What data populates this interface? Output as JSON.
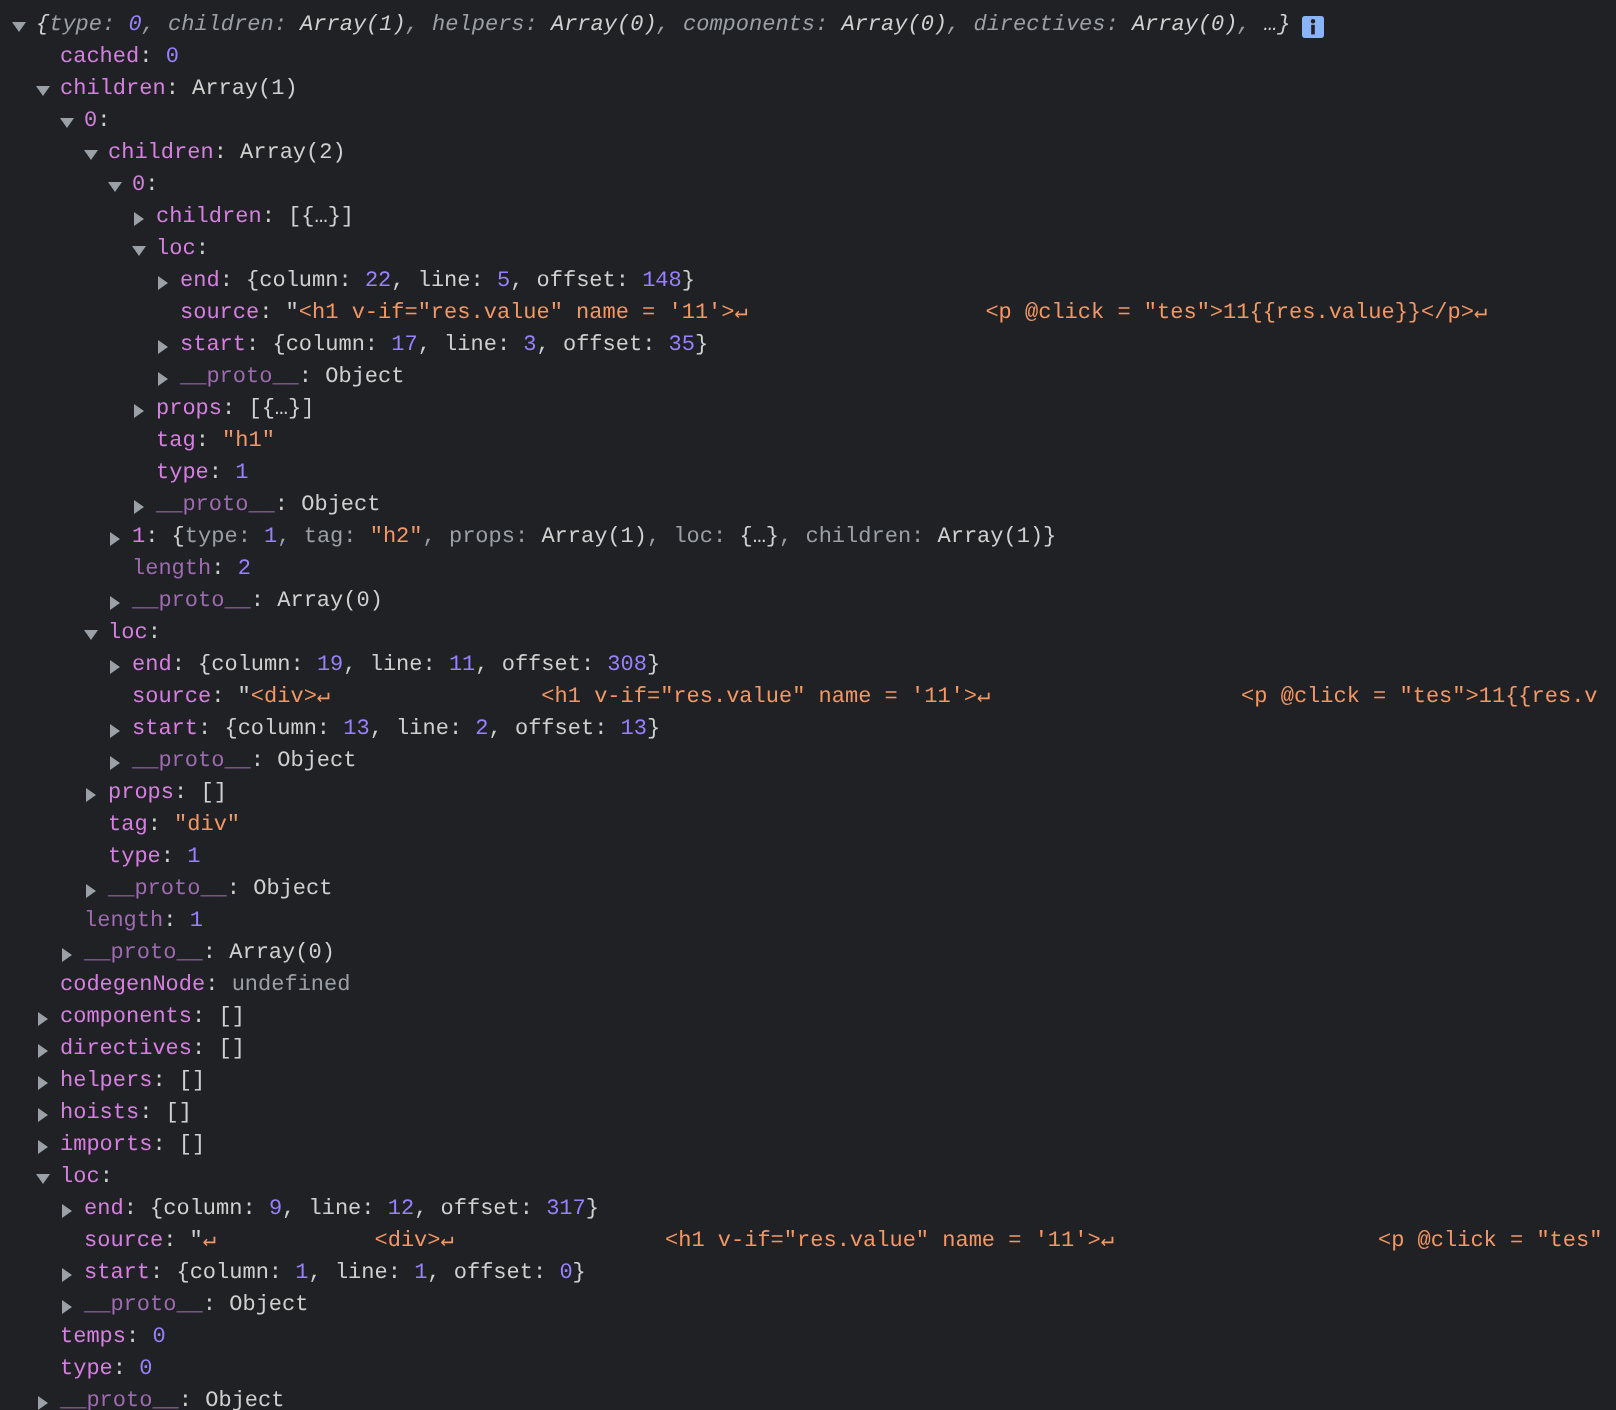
{
  "console": {
    "root": {
      "expanded": true,
      "info_badge": true,
      "preview": [
        {
          "kind": "plain",
          "text": "{"
        },
        {
          "kind": "preview-key",
          "text": "type: "
        },
        {
          "kind": "number",
          "text": "0"
        },
        {
          "kind": "preview-key",
          "text": ", children: "
        },
        {
          "kind": "plain",
          "text": "Array(1)"
        },
        {
          "kind": "preview-key",
          "text": ", helpers: "
        },
        {
          "kind": "plain",
          "text": "Array(0)"
        },
        {
          "kind": "preview-key",
          "text": ", components: "
        },
        {
          "kind": "plain",
          "text": "Array(0)"
        },
        {
          "kind": "preview-key",
          "text": ", directives: "
        },
        {
          "kind": "plain",
          "text": "Array(0)"
        },
        {
          "kind": "preview-key",
          "text": ", "
        },
        {
          "kind": "plain",
          "text": "…}"
        }
      ],
      "children": [
        {
          "key": "cached",
          "kind": "property",
          "tokens": [
            {
              "kind": "plain",
              "text": ": "
            },
            {
              "kind": "number",
              "text": "0"
            }
          ]
        },
        {
          "key": "children",
          "kind": "property",
          "expanded": true,
          "tokens": [
            {
              "kind": "plain",
              "text": ": Array(1)"
            }
          ],
          "children": [
            {
              "key": "0",
              "kind": "property",
              "expanded": true,
              "tokens": [
                {
                  "kind": "plain",
                  "text": ":"
                }
              ],
              "children": [
                {
                  "key": "children",
                  "kind": "property",
                  "expanded": true,
                  "tokens": [
                    {
                      "kind": "plain",
                      "text": ": Array(2)"
                    }
                  ],
                  "children": [
                    {
                      "key": "0",
                      "kind": "property",
                      "expanded": true,
                      "tokens": [
                        {
                          "kind": "plain",
                          "text": ":"
                        }
                      ],
                      "children": [
                        {
                          "key": "children",
                          "kind": "property",
                          "expanded": false,
                          "tokens": [
                            {
                              "kind": "plain",
                              "text": ": [{…}]"
                            }
                          ]
                        },
                        {
                          "key": "loc",
                          "kind": "property",
                          "expanded": true,
                          "tokens": [
                            {
                              "kind": "plain",
                              "text": ":"
                            }
                          ],
                          "children": [
                            {
                              "key": "end",
                              "kind": "property",
                              "expanded": false,
                              "tokens": [
                                {
                                  "kind": "plain",
                                  "text": ": {column: "
                                },
                                {
                                  "kind": "number",
                                  "text": "22"
                                },
                                {
                                  "kind": "plain",
                                  "text": ", line: "
                                },
                                {
                                  "kind": "number",
                                  "text": "5"
                                },
                                {
                                  "kind": "plain",
                                  "text": ", offset: "
                                },
                                {
                                  "kind": "number",
                                  "text": "148"
                                },
                                {
                                  "kind": "plain",
                                  "text": "}"
                                }
                              ]
                            },
                            {
                              "key": "source",
                              "kind": "property",
                              "tokens": [
                                {
                                  "kind": "plain",
                                  "text": ": \""
                                },
                                {
                                  "kind": "string",
                                  "text": "<h1 v-if=\"res.value\" name = '11'>↵                  <p @click = \"tes\">11{{res.value}}</p>↵"
                                }
                              ]
                            },
                            {
                              "key": "start",
                              "kind": "property",
                              "expanded": false,
                              "tokens": [
                                {
                                  "kind": "plain",
                                  "text": ": {column: "
                                },
                                {
                                  "kind": "number",
                                  "text": "17"
                                },
                                {
                                  "kind": "plain",
                                  "text": ", line: "
                                },
                                {
                                  "kind": "number",
                                  "text": "3"
                                },
                                {
                                  "kind": "plain",
                                  "text": ", offset: "
                                },
                                {
                                  "kind": "number",
                                  "text": "35"
                                },
                                {
                                  "kind": "plain",
                                  "text": "}"
                                }
                              ]
                            },
                            {
                              "key": "__proto__",
                              "kind": "internal",
                              "expanded": false,
                              "tokens": [
                                {
                                  "kind": "plain",
                                  "text": ": Object"
                                }
                              ]
                            }
                          ]
                        },
                        {
                          "key": "props",
                          "kind": "property",
                          "expanded": false,
                          "tokens": [
                            {
                              "kind": "plain",
                              "text": ": [{…}]"
                            }
                          ]
                        },
                        {
                          "key": "tag",
                          "kind": "property",
                          "tokens": [
                            {
                              "kind": "plain",
                              "text": ": "
                            },
                            {
                              "kind": "string",
                              "text": "\"h1\""
                            }
                          ]
                        },
                        {
                          "key": "type",
                          "kind": "property",
                          "tokens": [
                            {
                              "kind": "plain",
                              "text": ": "
                            },
                            {
                              "kind": "number",
                              "text": "1"
                            }
                          ]
                        },
                        {
                          "key": "__proto__",
                          "kind": "internal",
                          "expanded": false,
                          "tokens": [
                            {
                              "kind": "plain",
                              "text": ": Object"
                            }
                          ]
                        }
                      ]
                    },
                    {
                      "key": "1",
                      "kind": "property",
                      "expanded": false,
                      "tokens": [
                        {
                          "kind": "plain",
                          "text": ": {"
                        },
                        {
                          "kind": "preview-key",
                          "text": "type: "
                        },
                        {
                          "kind": "number",
                          "text": "1"
                        },
                        {
                          "kind": "preview-key",
                          "text": ", tag: "
                        },
                        {
                          "kind": "string",
                          "text": "\"h2\""
                        },
                        {
                          "kind": "preview-key",
                          "text": ", props: "
                        },
                        {
                          "kind": "plain",
                          "text": "Array(1)"
                        },
                        {
                          "kind": "preview-key",
                          "text": ", loc: "
                        },
                        {
                          "kind": "plain",
                          "text": "{…}"
                        },
                        {
                          "kind": "preview-key",
                          "text": ", children: "
                        },
                        {
                          "kind": "plain",
                          "text": "Array(1)}"
                        }
                      ]
                    },
                    {
                      "key": "length",
                      "kind": "internal",
                      "tokens": [
                        {
                          "kind": "plain",
                          "text": ": "
                        },
                        {
                          "kind": "number",
                          "text": "2"
                        }
                      ]
                    },
                    {
                      "key": "__proto__",
                      "kind": "internal",
                      "expanded": false,
                      "tokens": [
                        {
                          "kind": "plain",
                          "text": ": Array(0)"
                        }
                      ]
                    }
                  ]
                },
                {
                  "key": "loc",
                  "kind": "property",
                  "expanded": true,
                  "tokens": [
                    {
                      "kind": "plain",
                      "text": ":"
                    }
                  ],
                  "children": [
                    {
                      "key": "end",
                      "kind": "property",
                      "expanded": false,
                      "tokens": [
                        {
                          "kind": "plain",
                          "text": ": {column: "
                        },
                        {
                          "kind": "number",
                          "text": "19"
                        },
                        {
                          "kind": "plain",
                          "text": ", line: "
                        },
                        {
                          "kind": "number",
                          "text": "11"
                        },
                        {
                          "kind": "plain",
                          "text": ", offset: "
                        },
                        {
                          "kind": "number",
                          "text": "308"
                        },
                        {
                          "kind": "plain",
                          "text": "}"
                        }
                      ]
                    },
                    {
                      "key": "source",
                      "kind": "property",
                      "tokens": [
                        {
                          "kind": "plain",
                          "text": ": \""
                        },
                        {
                          "kind": "string",
                          "text": "<div>↵                <h1 v-if=\"res.value\" name = '11'>↵                   <p @click = \"tes\">11{{res.v"
                        }
                      ]
                    },
                    {
                      "key": "start",
                      "kind": "property",
                      "expanded": false,
                      "tokens": [
                        {
                          "kind": "plain",
                          "text": ": {column: "
                        },
                        {
                          "kind": "number",
                          "text": "13"
                        },
                        {
                          "kind": "plain",
                          "text": ", line: "
                        },
                        {
                          "kind": "number",
                          "text": "2"
                        },
                        {
                          "kind": "plain",
                          "text": ", offset: "
                        },
                        {
                          "kind": "number",
                          "text": "13"
                        },
                        {
                          "kind": "plain",
                          "text": "}"
                        }
                      ]
                    },
                    {
                      "key": "__proto__",
                      "kind": "internal",
                      "expanded": false,
                      "tokens": [
                        {
                          "kind": "plain",
                          "text": ": Object"
                        }
                      ]
                    }
                  ]
                },
                {
                  "key": "props",
                  "kind": "property",
                  "expanded": false,
                  "tokens": [
                    {
                      "kind": "plain",
                      "text": ": []"
                    }
                  ]
                },
                {
                  "key": "tag",
                  "kind": "property",
                  "tokens": [
                    {
                      "kind": "plain",
                      "text": ": "
                    },
                    {
                      "kind": "string",
                      "text": "\"div\""
                    }
                  ]
                },
                {
                  "key": "type",
                  "kind": "property",
                  "tokens": [
                    {
                      "kind": "plain",
                      "text": ": "
                    },
                    {
                      "kind": "number",
                      "text": "1"
                    }
                  ]
                },
                {
                  "key": "__proto__",
                  "kind": "internal",
                  "expanded": false,
                  "tokens": [
                    {
                      "kind": "plain",
                      "text": ": Object"
                    }
                  ]
                }
              ]
            },
            {
              "key": "length",
              "kind": "internal",
              "tokens": [
                {
                  "kind": "plain",
                  "text": ": "
                },
                {
                  "kind": "number",
                  "text": "1"
                }
              ]
            },
            {
              "key": "__proto__",
              "kind": "internal",
              "expanded": false,
              "tokens": [
                {
                  "kind": "plain",
                  "text": ": Array(0)"
                }
              ]
            }
          ]
        },
        {
          "key": "codegenNode",
          "kind": "property",
          "tokens": [
            {
              "kind": "plain",
              "text": ": "
            },
            {
              "kind": "undefined",
              "text": "undefined"
            }
          ]
        },
        {
          "key": "components",
          "kind": "property",
          "expanded": false,
          "tokens": [
            {
              "kind": "plain",
              "text": ": []"
            }
          ]
        },
        {
          "key": "directives",
          "kind": "property",
          "expanded": false,
          "tokens": [
            {
              "kind": "plain",
              "text": ": []"
            }
          ]
        },
        {
          "key": "helpers",
          "kind": "property",
          "expanded": false,
          "tokens": [
            {
              "kind": "plain",
              "text": ": []"
            }
          ]
        },
        {
          "key": "hoists",
          "kind": "property",
          "expanded": false,
          "tokens": [
            {
              "kind": "plain",
              "text": ": []"
            }
          ]
        },
        {
          "key": "imports",
          "kind": "property",
          "expanded": false,
          "tokens": [
            {
              "kind": "plain",
              "text": ": []"
            }
          ]
        },
        {
          "key": "loc",
          "kind": "property",
          "expanded": true,
          "tokens": [
            {
              "kind": "plain",
              "text": ":"
            }
          ],
          "children": [
            {
              "key": "end",
              "kind": "property",
              "expanded": false,
              "tokens": [
                {
                  "kind": "plain",
                  "text": ": {column: "
                },
                {
                  "kind": "number",
                  "text": "9"
                },
                {
                  "kind": "plain",
                  "text": ", line: "
                },
                {
                  "kind": "number",
                  "text": "12"
                },
                {
                  "kind": "plain",
                  "text": ", offset: "
                },
                {
                  "kind": "number",
                  "text": "317"
                },
                {
                  "kind": "plain",
                  "text": "}"
                }
              ]
            },
            {
              "key": "source",
              "kind": "property",
              "tokens": [
                {
                  "kind": "plain",
                  "text": ": \""
                },
                {
                  "kind": "string",
                  "text": "↵            <div>↵                <h1 v-if=\"res.value\" name = '11'>↵                    <p @click = \"tes\""
                }
              ]
            },
            {
              "key": "start",
              "kind": "property",
              "expanded": false,
              "tokens": [
                {
                  "kind": "plain",
                  "text": ": {column: "
                },
                {
                  "kind": "number",
                  "text": "1"
                },
                {
                  "kind": "plain",
                  "text": ", line: "
                },
                {
                  "kind": "number",
                  "text": "1"
                },
                {
                  "kind": "plain",
                  "text": ", offset: "
                },
                {
                  "kind": "number",
                  "text": "0"
                },
                {
                  "kind": "plain",
                  "text": "}"
                }
              ]
            },
            {
              "key": "__proto__",
              "kind": "internal",
              "expanded": false,
              "tokens": [
                {
                  "kind": "plain",
                  "text": ": Object"
                }
              ]
            }
          ]
        },
        {
          "key": "temps",
          "kind": "property",
          "tokens": [
            {
              "kind": "plain",
              "text": ": "
            },
            {
              "kind": "number",
              "text": "0"
            }
          ]
        },
        {
          "key": "type",
          "kind": "property",
          "tokens": [
            {
              "kind": "plain",
              "text": ": "
            },
            {
              "kind": "number",
              "text": "0"
            }
          ]
        },
        {
          "key": "__proto__",
          "kind": "internal",
          "expanded": false,
          "tokens": [
            {
              "kind": "plain",
              "text": ": Object"
            }
          ]
        }
      ]
    }
  }
}
